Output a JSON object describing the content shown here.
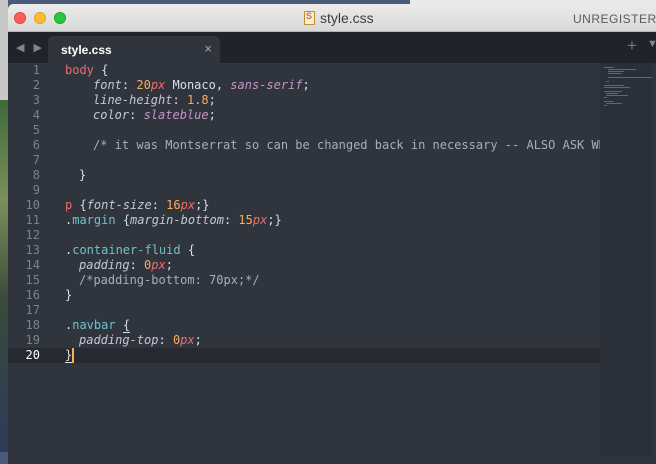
{
  "window": {
    "title": "style.css",
    "status": "UNREGISTERED"
  },
  "tabbar": {
    "nav": "◀ ▶",
    "tab_label": "style.css",
    "close_glyph": "×",
    "new_tab_glyph": "+",
    "arrow_glyph": "▼"
  },
  "editor": {
    "active_line": 20,
    "lines": [
      {
        "n": "1"
      },
      {
        "n": "2"
      },
      {
        "n": "3"
      },
      {
        "n": "4"
      },
      {
        "n": "5"
      },
      {
        "n": "6"
      },
      {
        "n": "7"
      },
      {
        "n": "8"
      },
      {
        "n": "9"
      },
      {
        "n": "10"
      },
      {
        "n": "11"
      },
      {
        "n": "12"
      },
      {
        "n": "13"
      },
      {
        "n": "14"
      },
      {
        "n": "15"
      },
      {
        "n": "16"
      },
      {
        "n": "17"
      },
      {
        "n": "18"
      },
      {
        "n": "19"
      },
      {
        "n": "20"
      }
    ],
    "code": {
      "l1_sel": "body",
      "l1_brace": " {",
      "l2_prop": "font",
      "l2_colon": ": ",
      "l2_num": "20",
      "l2_unit": "px",
      "l2_font": " Monaco, ",
      "l2_kw": "sans-serif",
      "l2_end": ";",
      "l3_prop": "line-height",
      "l3_colon": ": ",
      "l3_num": "1.8",
      "l3_end": ";",
      "l4_prop": "color",
      "l4_colon": ": ",
      "l4_kw": "slateblue",
      "l4_end": ";",
      "l6_comment": "/* it was Montserrat so can be changed back in necessary -- ALSO ASK WHY",
      "l8_brace": "}",
      "l10_sel": "p",
      "l10_open": " {",
      "l10_prop": "font-size",
      "l10_colon": ": ",
      "l10_num": "16",
      "l10_unit": "px",
      "l10_end": ";}",
      "l11_dot": ".",
      "l11_cls": "margin",
      "l11_open": " {",
      "l11_prop": "margin-bottom",
      "l11_colon": ": ",
      "l11_num": "15",
      "l11_unit": "px",
      "l11_end": ";}",
      "l13_dot": ".",
      "l13_cls": "container-fluid",
      "l13_open": " {",
      "l14_prop": "padding",
      "l14_colon": ": ",
      "l14_num": "0",
      "l14_unit": "px",
      "l14_end": ";",
      "l15_comment": "/*padding-bottom: 70px;*/",
      "l16_brace": "}",
      "l18_dot": ".",
      "l18_cls": "navbar",
      "l18_space": " ",
      "l18_open": "{",
      "l19_prop": "padding-top",
      "l19_colon": ": ",
      "l19_num": "0",
      "l19_unit": "px",
      "l19_end": ";",
      "l20_brace": "}"
    }
  }
}
